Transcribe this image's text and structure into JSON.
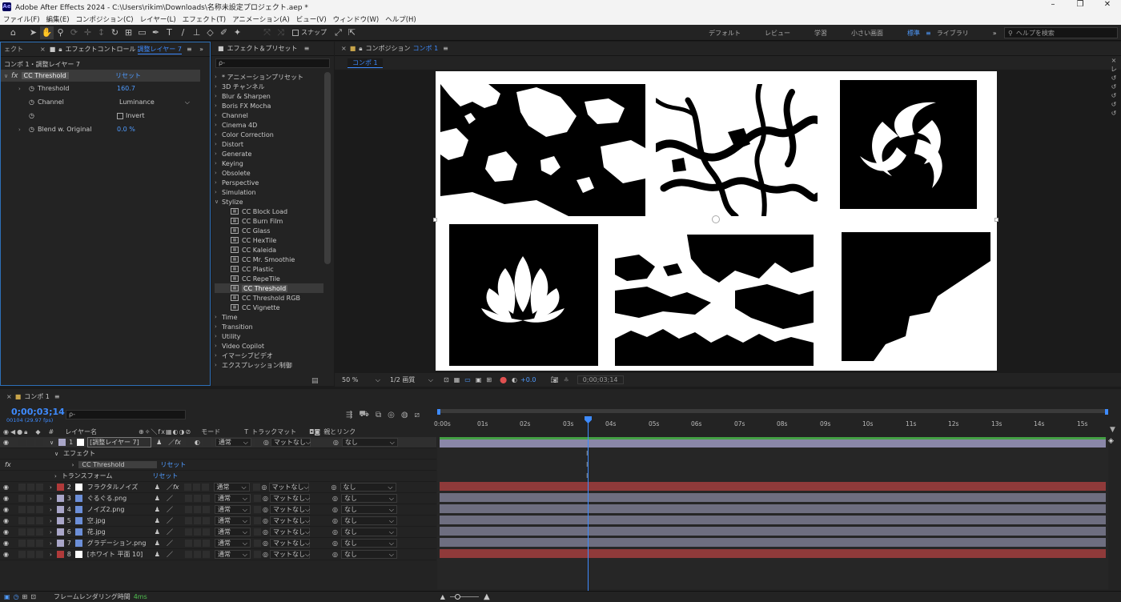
{
  "window": {
    "app_logo": "Ae",
    "title": "Adobe After Effects 2024 - C:\\Users\\rikim\\Downloads\\名称未設定プロジェクト.aep *",
    "min": "–",
    "max": "❐",
    "close": "✕"
  },
  "menu": [
    "ファイル(F)",
    "編集(E)",
    "コンポジション(C)",
    "レイヤー(L)",
    "エフェクト(T)",
    "アニメーション(A)",
    "ビュー(V)",
    "ウィンドウ(W)",
    "ヘルプ(H)"
  ],
  "toolbar": {
    "snap_label": "スナップ",
    "workspaces": [
      "デフォルト",
      "レビュー",
      "学習",
      "小さい画面",
      "標準",
      "ライブラリ"
    ],
    "active_workspace": "標準",
    "help_search_placeholder": "ヘルプを検索",
    "more": "»"
  },
  "effect_controls": {
    "left_tab": "ェクト",
    "tab_label": "エフェクトコントロール",
    "tab_layer": "調整レイヤー 7",
    "menu": "≡",
    "expand": "»",
    "breadcrumb": "コンポ 1・調整レイヤー 7",
    "effect_name": "CC Threshold",
    "reset": "リセット",
    "params": [
      {
        "name": "Threshold",
        "value": "160.7"
      },
      {
        "name": "Channel",
        "value": "Luminance"
      },
      {
        "name": "",
        "value": "Invert"
      },
      {
        "name": "Blend w. Original",
        "value": "0.0 %"
      }
    ]
  },
  "effects_presets": {
    "tab_label": "エフェクト＆プリセット",
    "menu": "≡",
    "search_placeholder": "ρ-",
    "categories_top": [
      "* アニメーションプリセット",
      "3D チャンネル",
      "Blur & Sharpen",
      "Boris FX Mocha",
      "Channel",
      "Cinema 4D",
      "Color Correction",
      "Distort",
      "Generate",
      "Keying",
      "Obsolete",
      "Perspective",
      "Simulation"
    ],
    "expanded_category": "Stylize",
    "stylize_items": [
      "CC Block Load",
      "CC Burn Film",
      "CC Glass",
      "CC HexTile",
      "CC Kaleida",
      "CC Mr. Smoothie",
      "CC Plastic",
      "CC RepeTile",
      "CC Threshold",
      "CC Threshold RGB",
      "CC Vignette"
    ],
    "selected_item": "CC Threshold",
    "categories_bottom": [
      "Time",
      "Transition",
      "Utility",
      "Video Copilot",
      "イマーシブビデオ",
      "エクスプレッション制御"
    ]
  },
  "composition": {
    "tab_label": "コンポジション",
    "comp_name": "コンポ 1",
    "menu": "≡",
    "flow_tab": "コンポ 1",
    "zoom": "50 %",
    "resolution": "1/2 画質",
    "exposure": "+0.0",
    "timecode": "0;00;03;14"
  },
  "timeline": {
    "tab_label": "コンポ 1",
    "menu": "≡",
    "timecode": "0;00;03;14",
    "frame_info": "00104 (29.97 fps)",
    "search_placeholder": "ρ-",
    "columns": {
      "num": "#",
      "layer_name": "レイヤー名",
      "mode": "モード",
      "t": "T",
      "track_matte": "トラックマット",
      "parent": "親とリンク"
    },
    "ruler": [
      "0:00s",
      "01s",
      "02s",
      "03s",
      "04s",
      "05s",
      "06s",
      "07s",
      "08s",
      "09s",
      "10s",
      "11s",
      "12s",
      "13s",
      "14s",
      "15s"
    ],
    "effects_label": "エフェクト",
    "cc_threshold": "CC Threshold",
    "transform": "トランスフォーム",
    "reset": "リセット",
    "layers": [
      {
        "num": "1",
        "name": "[調整レイヤー 7]",
        "mode": "通常",
        "matte": "マットなし",
        "parent": "なし",
        "color": "#a9a6c8",
        "bar": "#8a87a8"
      },
      {
        "num": "2",
        "name": "フラクタルノイズ",
        "mode": "通常",
        "matte": "マットなし",
        "parent": "なし",
        "color": "#b03a3a",
        "bar": "#8f3a3a"
      },
      {
        "num": "3",
        "name": "ぐるぐる.png",
        "mode": "通常",
        "matte": "マットなし",
        "parent": "なし",
        "color": "#a9a6c8",
        "bar": "#6e6e80"
      },
      {
        "num": "4",
        "name": "ノイズ2.png",
        "mode": "通常",
        "matte": "マットなし",
        "parent": "なし",
        "color": "#a9a6c8",
        "bar": "#6e6e80"
      },
      {
        "num": "5",
        "name": "空.jpg",
        "mode": "通常",
        "matte": "マットなし",
        "parent": "なし",
        "color": "#a9a6c8",
        "bar": "#6e6e80"
      },
      {
        "num": "6",
        "name": "花.jpg",
        "mode": "通常",
        "matte": "マットなし",
        "parent": "なし",
        "color": "#a9a6c8",
        "bar": "#6e6e80"
      },
      {
        "num": "7",
        "name": "グラデーション.png",
        "mode": "通常",
        "matte": "マットなし",
        "parent": "なし",
        "color": "#a9a6c8",
        "bar": "#6e6e80"
      },
      {
        "num": "8",
        "name": "[ホワイト 平面 10]",
        "mode": "通常",
        "matte": "マットなし",
        "parent": "なし",
        "color": "#b03a3a",
        "bar": "#8f3a3a"
      }
    ]
  },
  "status": {
    "render_label": "フレームレンダリング時間",
    "render_time": "4ms"
  }
}
